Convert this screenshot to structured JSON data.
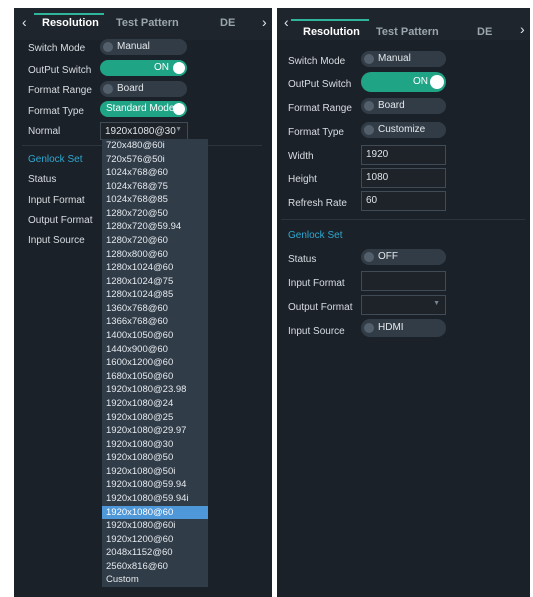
{
  "left_panel": {
    "tabs": [
      "Resolution",
      "Test Pattern",
      "DE"
    ],
    "nav_prev": "‹",
    "nav_next": "›",
    "rows": {
      "switch_mode": {
        "label": "Switch Mode",
        "value": "Manual"
      },
      "output_switch": {
        "label": "OutPut Switch",
        "value": "ON"
      },
      "format_range": {
        "label": "Format Range",
        "value": "Board"
      },
      "format_type": {
        "label": "Format Type",
        "value": "Standard Mode"
      },
      "normal": {
        "label": "Normal",
        "value": "1920x1080@30"
      }
    },
    "genlock": {
      "title": "Genlock Set",
      "status_label": "Status",
      "input_format_label": "Input Format",
      "output_format_label": "Output Format",
      "input_source_label": "Input Source"
    },
    "dropdown_options": [
      "720x480@60i",
      "720x576@50i",
      "1024x768@60",
      "1024x768@75",
      "1024x768@85",
      "1280x720@50",
      "1280x720@59.94",
      "1280x720@60",
      "1280x800@60",
      "1280x1024@60",
      "1280x1024@75",
      "1280x1024@85",
      "1360x768@60",
      "1366x768@60",
      "1400x1050@60",
      "1440x900@60",
      "1600x1200@60",
      "1680x1050@60",
      "1920x1080@23.98",
      "1920x1080@24",
      "1920x1080@25",
      "1920x1080@29.97",
      "1920x1080@30",
      "1920x1080@50",
      "1920x1080@50i",
      "1920x1080@59.94",
      "1920x1080@59.94i",
      "1920x1080@60",
      "1920x1080@60i",
      "1920x1200@60",
      "2048x1152@60",
      "2560x816@60",
      "Custom"
    ],
    "dropdown_selected": "1920x1080@60"
  },
  "right_panel": {
    "tabs": [
      "Resolution",
      "Test Pattern",
      "DE"
    ],
    "nav_prev": "‹",
    "nav_next": "›",
    "rows": {
      "switch_mode": {
        "label": "Switch Mode",
        "value": "Manual"
      },
      "output_switch": {
        "label": "OutPut Switch",
        "value": "ON"
      },
      "format_range": {
        "label": "Format Range",
        "value": "Board"
      },
      "format_type": {
        "label": "Format Type",
        "value": "Customize"
      },
      "width": {
        "label": "Width",
        "value": "1920"
      },
      "height": {
        "label": "Height",
        "value": "1080"
      },
      "refresh_rate": {
        "label": "Refresh Rate",
        "value": "60"
      }
    },
    "genlock": {
      "title": "Genlock Set",
      "status": {
        "label": "Status",
        "value": "OFF"
      },
      "input_format": {
        "label": "Input Format",
        "value": ""
      },
      "output_format": {
        "label": "Output Format",
        "value": ""
      },
      "input_source": {
        "label": "Input Source",
        "value": "HDMI"
      }
    }
  },
  "colors": {
    "panel_bg": "#1b2128",
    "accent_green": "#20a486",
    "section_blue": "#2fa8d0",
    "dropdown_bg": "#313c49",
    "selected_item": "#4e97d8"
  }
}
